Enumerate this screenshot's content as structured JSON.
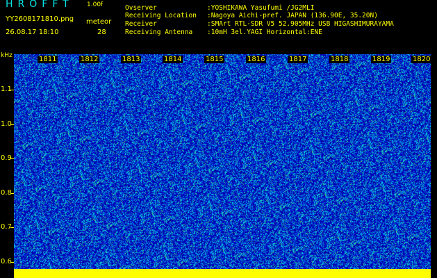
{
  "header": {
    "app_title": "HROFFT",
    "version": "1.00f",
    "filename": "YY2608171810.png",
    "datetime": "26.08.17 18:10",
    "mode_label": "meteor",
    "count": "28"
  },
  "info": [
    {
      "key": "Ovserver",
      "value": ":YOSHIKAWA Yasufumi /JG2MLI"
    },
    {
      "key": "Receiving Location",
      "value": ":Nagoya Aichi-pref. JAPAN (136.90E, 35.20N)"
    },
    {
      "key": "Receiver",
      "value": ":SMArt RTL-SDR V5 52.905MHz USB HIGASHIMURAYAMA"
    },
    {
      "key": "Receiving Antenna",
      "value": ":10mH 3el.YAGI Horizontal:ENE"
    }
  ],
  "axis": {
    "y_unit": "kHz",
    "y_ticks": [
      "1.1",
      "1.0",
      "0.9",
      "0.8",
      "0.7",
      "0.6"
    ],
    "x_ticks": [
      "1811",
      "1812",
      "1813",
      "1814",
      "1815",
      "1816",
      "1817",
      "1818",
      "1819",
      "1820"
    ]
  },
  "colors": {
    "background": "#000000",
    "label": "#ffff00",
    "title": "#00e6e6",
    "noise_dark": "#0000c8",
    "noise_light": "#00c8ff"
  }
}
